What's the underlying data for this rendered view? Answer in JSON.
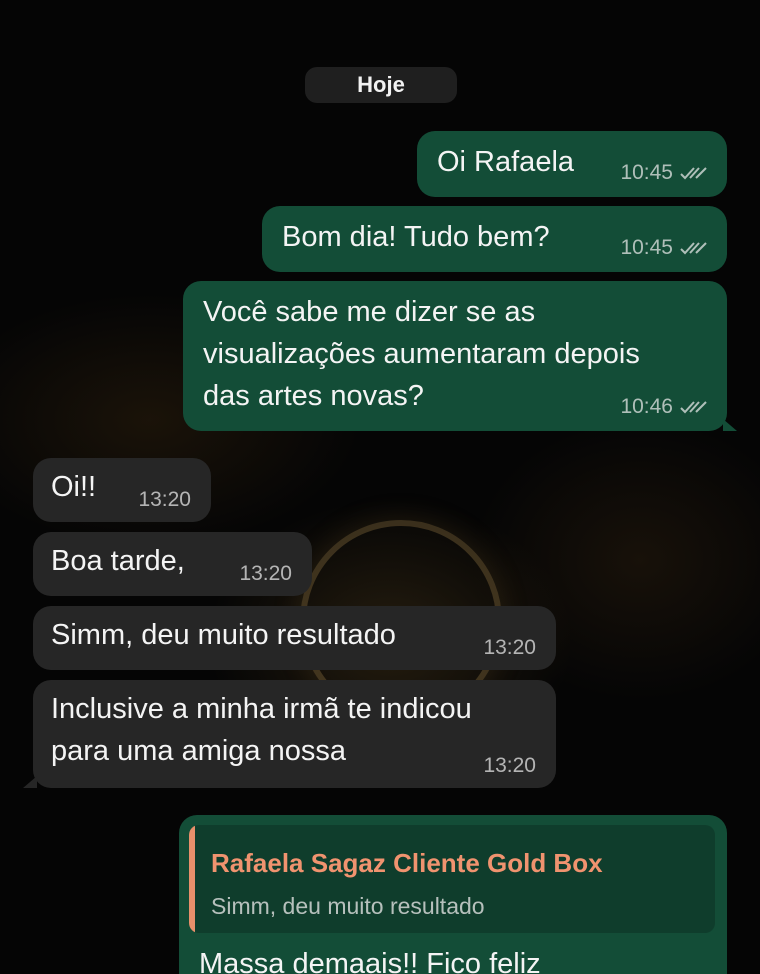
{
  "chat": {
    "date_separator": "Hoje",
    "messages": [
      {
        "direction": "out",
        "text": "Oi Rafaela",
        "time": "10:45",
        "status": "read"
      },
      {
        "direction": "out",
        "text": "Bom dia! Tudo bem?",
        "time": "10:45",
        "status": "read"
      },
      {
        "direction": "out",
        "lines": [
          "Você sabe me dizer se as",
          "visualizações aumentaram depois",
          "das artes novas?"
        ],
        "time": "10:46",
        "status": "read"
      },
      {
        "direction": "in",
        "text": "Oi!!",
        "time": "13:20"
      },
      {
        "direction": "in",
        "text": "Boa tarde,",
        "time": "13:20"
      },
      {
        "direction": "in",
        "text": "Simm, deu muito resultado",
        "time": "13:20"
      },
      {
        "direction": "in",
        "lines": [
          "Inclusive a minha irmã te indicou",
          "para uma amiga nossa"
        ],
        "time": "13:20"
      },
      {
        "direction": "out",
        "reply_to": {
          "author": "Rafaela Sagaz Cliente Gold Box",
          "text": "Simm, deu muito resultado"
        },
        "text": "Massa demaais!! Fico feliz"
      }
    ]
  },
  "colors": {
    "outgoing_bubble": "#134d37",
    "incoming_bubble": "#262626",
    "quote_accent": "#e8906b",
    "background": "#050505"
  },
  "icons": {
    "read_receipt": "double-check-icon"
  }
}
